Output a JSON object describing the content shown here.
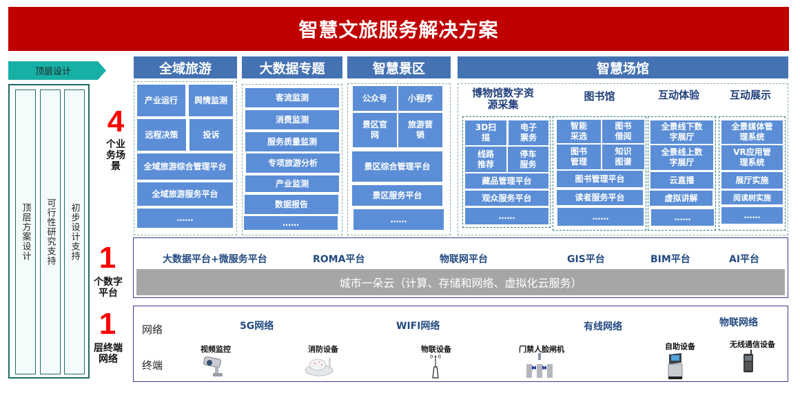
{
  "title": "智慧文旅服务解决方案",
  "left_panel": {
    "header": "顶层设计",
    "columns": [
      "顶层方案设计",
      "可行性研究支持",
      "初步设计支持"
    ]
  },
  "layers": [
    {
      "number": "4",
      "label": "个业务场景"
    },
    {
      "number": "1",
      "label": "个数字平台"
    },
    {
      "number": "1",
      "label": "层终端网络"
    }
  ],
  "scenarios": {
    "quanyu": {
      "title": "全域旅游",
      "cells": [
        "产业运行",
        "舆情监测",
        "远程决策",
        "投诉",
        "全域旅游综合管理平台",
        "全域旅游服务平台",
        "……"
      ]
    },
    "bigdata": {
      "title": "大数据专题",
      "cells": [
        "客流监测",
        "消费监测",
        "服务质量监测",
        "专项旅游分析",
        "产业监测",
        "数据报告",
        "……"
      ]
    },
    "scenic": {
      "title": "智慧景区",
      "cells": [
        "公众号",
        "小程序",
        "景区官网",
        "旅游营销",
        "景区综合管理平台",
        "景区服务平台",
        "……"
      ]
    },
    "venue": {
      "title": "智慧场馆",
      "museum": {
        "title": "博物馆数字资源采集",
        "cells": [
          "3D扫描",
          "电子票务",
          "线路推荐",
          "停车服务",
          "藏品管理平台",
          "观众服务平台",
          "……"
        ]
      },
      "library": {
        "title": "图书馆",
        "cells": [
          "智能采选",
          "图书借阅",
          "图书管理",
          "知识图谱",
          "图书管理平台",
          "读者服务平台",
          "……"
        ]
      },
      "experience": {
        "title": "互动体验",
        "cells": [
          "全景线下数字展厅",
          "全景线上数字展厅",
          "云直播",
          "虚拟讲解",
          "……"
        ]
      },
      "display": {
        "title": "互动展示",
        "cells": [
          "全景媒体管理系统",
          "VR应用管理系统",
          "展厅实施",
          "阅读树实施",
          "……"
        ]
      }
    }
  },
  "platforms": {
    "items": [
      "大数据平台+微服务平台",
      "ROMA平台",
      "物联网平台",
      "GIS平台",
      "BIM平台",
      "AI平台"
    ],
    "cloud": "城市一朵云（计算、存储和网络、虚拟化云服务）"
  },
  "network": {
    "network_label": "网络",
    "terminal_label": "终端",
    "networks": [
      "5G网络",
      "WIFI网络",
      "有线网络",
      "物联网络"
    ],
    "devices": [
      {
        "label": "视频监控",
        "icon": "camera-icon"
      },
      {
        "label": "消防设备",
        "icon": "smoke-detector-icon"
      },
      {
        "label": "物联设备",
        "icon": "iot-antenna-icon"
      },
      {
        "label": "门禁人脸闸机",
        "icon": "turnstile-icon"
      },
      {
        "label": "自助设备",
        "icon": "kiosk-icon"
      },
      {
        "label": "无线通信设备",
        "icon": "radio-icon"
      }
    ]
  }
}
